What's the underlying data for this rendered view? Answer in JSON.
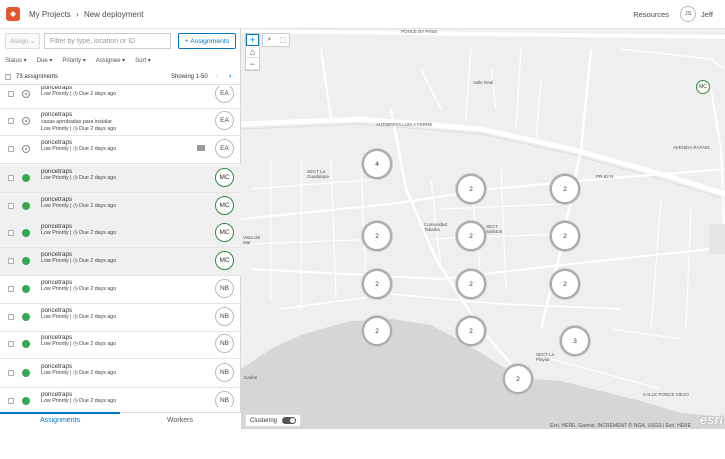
{
  "header": {
    "crumb_parent": "My Projects",
    "crumb_sep": "›",
    "crumb_current": "New deployment",
    "resources_label": "Resources",
    "user_initials": "JS",
    "user_name": "Jeff"
  },
  "toolbar": {
    "assign_label": "Assign ⌄",
    "search_placeholder": "Filter by type, location or ID",
    "assignments_button": "+ Assignments"
  },
  "filters": [
    "Status ▾",
    "Due ▾",
    "Priority ▾",
    "Assignee ▾",
    "Sort ▾"
  ],
  "list_header": {
    "count": "73 assignments",
    "showing": "Showing 1-50",
    "prev": "‹",
    "next": "›"
  },
  "rows": [
    {
      "title": "poncetraps",
      "desc": "",
      "priority": "Low Priority",
      "due": "◷ Due 2 days ago",
      "assignee": "EA",
      "status": "unassigned",
      "comment": false
    },
    {
      "title": "poncetraps",
      "desc": "casas aprobadas para instalar",
      "priority": "Low Priority",
      "due": "◷ Due 2 days ago",
      "assignee": "EA",
      "status": "unassigned",
      "comment": false
    },
    {
      "title": "poncetraps",
      "desc": "",
      "priority": "Low Priority",
      "due": "◷ Due 2 days ago",
      "assignee": "EA",
      "status": "unassigned",
      "comment": true
    },
    {
      "title": "poncetraps",
      "desc": "",
      "priority": "Low Priority",
      "due": "◷ Due 2 days ago",
      "assignee": "MC",
      "status": "assigned",
      "comment": false
    },
    {
      "title": "poncetraps",
      "desc": "",
      "priority": "Low Priority",
      "due": "◷ Due 2 days ago",
      "assignee": "MC",
      "status": "assigned",
      "comment": false
    },
    {
      "title": "poncetraps",
      "desc": "",
      "priority": "Low Priority",
      "due": "◷ Due 2 days ago",
      "assignee": "MC",
      "status": "assigned",
      "comment": false
    },
    {
      "title": "poncetraps",
      "desc": "",
      "priority": "Low Priority",
      "due": "◷ Due 2 days ago",
      "assignee": "MC",
      "status": "assigned",
      "comment": false
    },
    {
      "title": "poncetraps",
      "desc": "",
      "priority": "Low Priority",
      "due": "◷ Due 2 days ago",
      "assignee": "NB",
      "status": "assigned",
      "comment": false
    },
    {
      "title": "poncetraps",
      "desc": "",
      "priority": "Low Priority",
      "due": "◷ Due 2 days ago",
      "assignee": "NB",
      "status": "assigned",
      "comment": false
    },
    {
      "title": "poncetraps",
      "desc": "",
      "priority": "Low Priority",
      "due": "◷ Due 2 days ago",
      "assignee": "NB",
      "status": "assigned",
      "comment": false
    },
    {
      "title": "poncetraps",
      "desc": "",
      "priority": "Low Priority",
      "due": "◷ Due 2 days ago",
      "assignee": "NB",
      "status": "assigned",
      "comment": false
    },
    {
      "title": "poncetraps",
      "desc": "",
      "priority": "Low Priority",
      "due": "◷ Due 2 days ago",
      "assignee": "NB",
      "status": "assigned",
      "comment": false
    }
  ],
  "tabs": {
    "assignments": "Assignments",
    "workers": "Workers"
  },
  "map": {
    "zoom_in": "+",
    "home": "⌂",
    "zoom_out": "−",
    "search_tool": "⌕",
    "select_tool": "⬚",
    "clusters": [
      "4",
      "2",
      "2",
      "2",
      "2",
      "2",
      "2",
      "2",
      "2",
      "2",
      "3",
      "2"
    ],
    "worker_marker": "MC",
    "clustering_label": "Clustering",
    "attribution": "Esri, HERE, Garmin, INCREMENT P, NGA, USGS | Esri, HERE",
    "esri_logo": "esri",
    "labels": [
      "PONCE BY PASS",
      "AUTOPISTA LUIS A FERRE",
      "PR-52 N",
      "SECT La Guadalupe",
      "Comunidad Tabaiba",
      "SECT Salistral",
      "Valle Real",
      "Vista del Mar",
      "SECT La Playita",
      "Caribe",
      "AVENIDA RAFAEL",
      "CALLE PONCE VIEJO"
    ]
  }
}
